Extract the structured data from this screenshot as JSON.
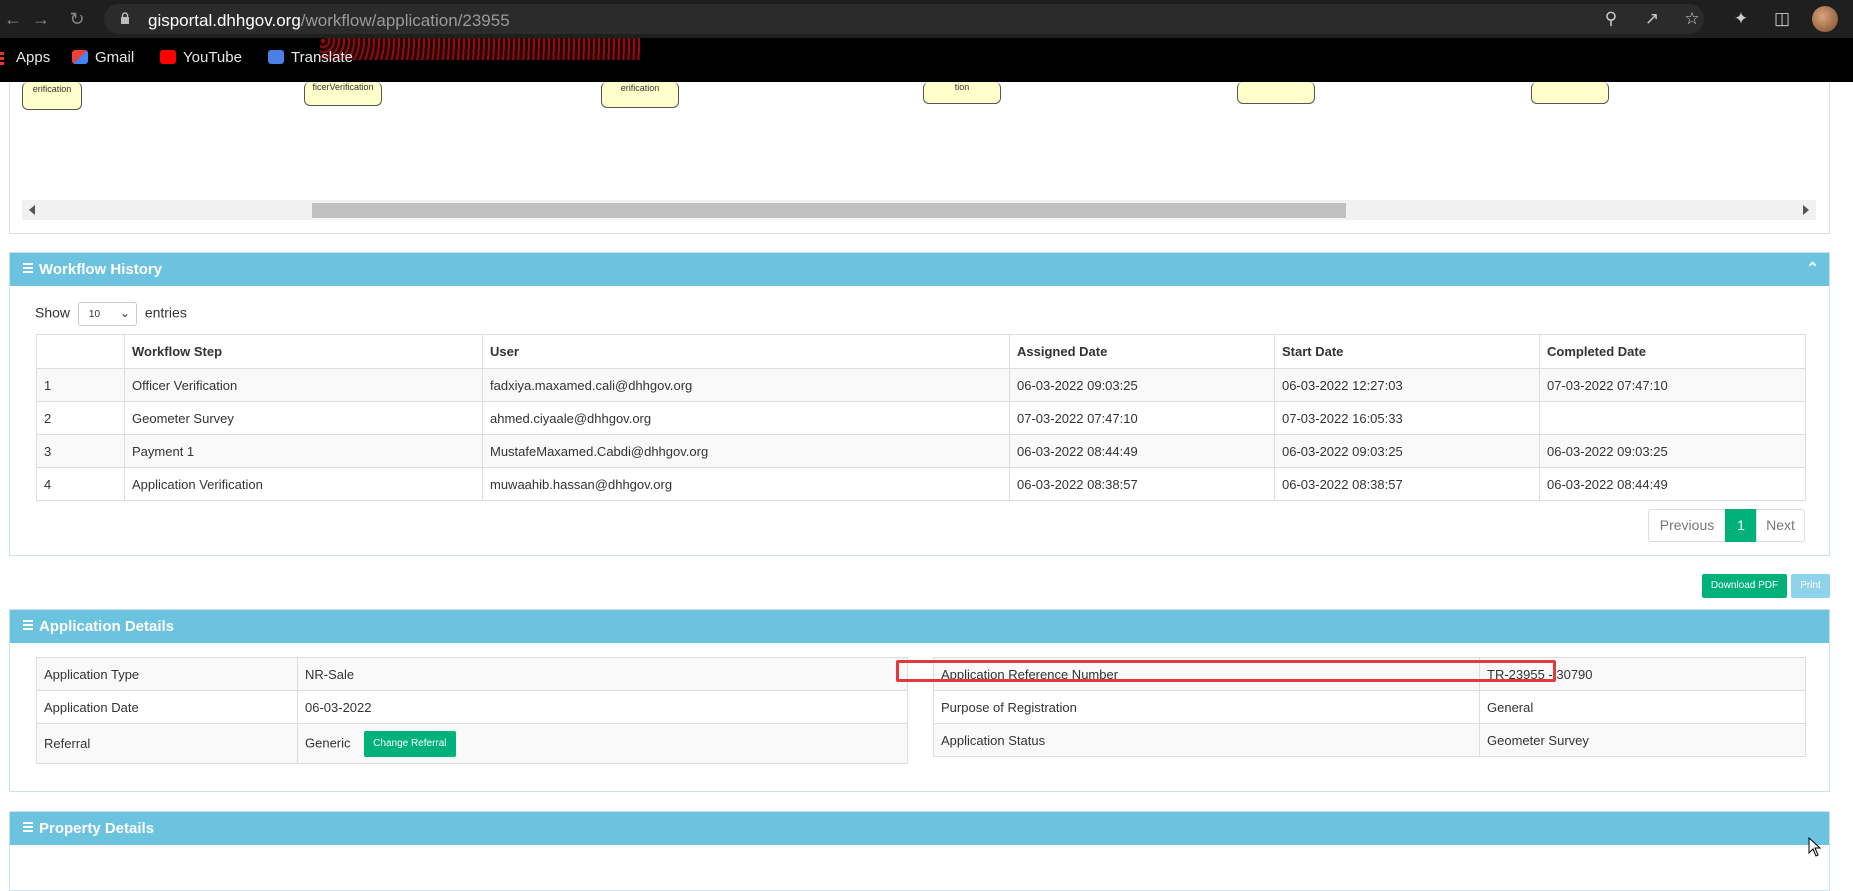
{
  "browser": {
    "url_host": "gisportal.dhhgov.org",
    "url_path": "/workflow/application/23955",
    "bookmarks": [
      {
        "label": "Apps"
      },
      {
        "label": "Gmail"
      },
      {
        "label": "YouTube"
      },
      {
        "label": "Translate"
      }
    ]
  },
  "workflow_diagram": {
    "nodes": [
      "erification",
      "ficerVerification",
      "erification",
      "tion",
      "",
      ""
    ]
  },
  "workflow_history": {
    "title": "Workflow History",
    "show_label": "Show",
    "entries_label": "entries",
    "page_size": "10",
    "columns": [
      "",
      "Workflow Step",
      "User",
      "Assigned Date",
      "Start Date",
      "Completed Date"
    ],
    "rows": [
      {
        "n": "1",
        "step": "Officer Verification",
        "user": "fadxiya.maxamed.cali@dhhgov.org",
        "assigned": "06-03-2022 09:03:25",
        "start": "06-03-2022 12:27:03",
        "completed": "07-03-2022 07:47:10"
      },
      {
        "n": "2",
        "step": "Geometer Survey",
        "user": "ahmed.ciyaale@dhhgov.org",
        "assigned": "07-03-2022 07:47:10",
        "start": "07-03-2022 16:05:33",
        "completed": ""
      },
      {
        "n": "3",
        "step": "Payment 1",
        "user": "MustafeMaxamed.Cabdi@dhhgov.org",
        "assigned": "06-03-2022 08:44:49",
        "start": "06-03-2022 09:03:25",
        "completed": "06-03-2022 09:03:25"
      },
      {
        "n": "4",
        "step": "Application Verification",
        "user": "muwaahib.hassan@dhhgov.org",
        "assigned": "06-03-2022 08:38:57",
        "start": "06-03-2022 08:38:57",
        "completed": "06-03-2022 08:44:49"
      }
    ],
    "pagination": {
      "previous": "Previous",
      "current": "1",
      "next": "Next"
    }
  },
  "actions": {
    "download_pdf": "Download PDF",
    "print": "Print"
  },
  "application_details": {
    "title": "Application Details",
    "left": [
      {
        "label": "Application Type",
        "value": "NR-Sale"
      },
      {
        "label": "Application Date",
        "value": "06-03-2022"
      },
      {
        "label": "Referral",
        "value": "Generic",
        "button": "Change Referral"
      }
    ],
    "right": [
      {
        "label": "Application Reference Number",
        "value": "TR-23955 - 30790"
      },
      {
        "label": "Purpose of Registration",
        "value": "General"
      },
      {
        "label": "Application Status",
        "value": "Geometer Survey"
      }
    ]
  },
  "property_details": {
    "title": "Property Details"
  },
  "colors": {
    "panel_header": "#6cc3e0",
    "accent_green": "#00b27a",
    "highlight_red": "#e03a3e"
  }
}
